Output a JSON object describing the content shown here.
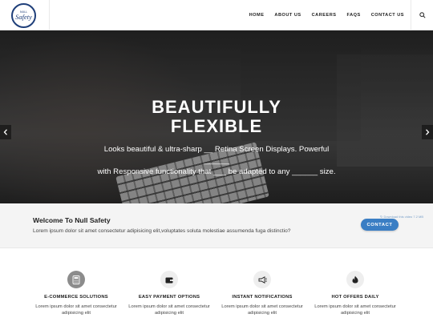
{
  "header": {
    "logo_small": "NULL",
    "logo_text": "Safety",
    "nav": [
      "HOME",
      "ABOUT US",
      "CAREERS",
      "FAQS",
      "CONTACT US"
    ]
  },
  "hero": {
    "title_line1": "BEAUTIFULLY",
    "title_line2": "FLEXIBLE",
    "subtitle_line1": "Looks beautiful & ultra-sharp __ Retina Screen Displays. Powerful ______",
    "subtitle_line2": "with Responsive functionality that ___ be adapted to any ______ size.",
    "prev_icon": "chevron-left-icon",
    "next_icon": "chevron-right-icon"
  },
  "welcome": {
    "title": "Welcome To Null Safety",
    "text": "Lorem ipsum dolor sit amet consectetur adipisicing elit,voluptates soluta molestiae assumenda fuga distinctio?",
    "button_label": "CONTACT",
    "video_note": "↻ Download this video 7.2 MB"
  },
  "features": [
    {
      "icon": "calculator-icon",
      "title": "E-COMMERCE SOLUTIONS",
      "line1": "Lorem ipsum dolor sit amet consectetur",
      "line2": "adipisicing elit"
    },
    {
      "icon": "wallet-icon",
      "title": "EASY PAYMENT OPTIONS",
      "line1": "Lorem ipsum dolor sit amet consectetur",
      "line2": "adipisicing elit"
    },
    {
      "icon": "megaphone-icon",
      "title": "INSTANT NOTIFICATIONS",
      "line1": "Lorem ipsum dolor sit amet consectetur",
      "line2": "adipisicing elit"
    },
    {
      "icon": "fire-icon",
      "title": "HOT OFFERS DAILY",
      "line1": "Lorem ipsum dolor sit amet consectetur",
      "line2": "adipisicing elit"
    }
  ],
  "colors": {
    "accent": "#3a7ec4",
    "logo": "#1f3f7a"
  }
}
